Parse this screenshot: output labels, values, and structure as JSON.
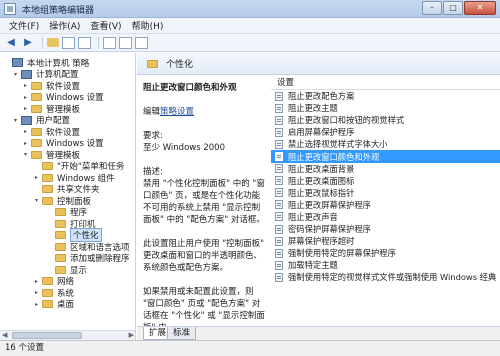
{
  "window": {
    "title": "本地组策略编辑器",
    "controls": [
      "–",
      "□",
      "✕"
    ]
  },
  "menu": [
    "文件(F)",
    "操作(A)",
    "查看(V)",
    "帮助(H)"
  ],
  "toolbar": {
    "back": "◀",
    "forward": "▶"
  },
  "tree": [
    {
      "label": "本地计算机 策略",
      "level": 0,
      "exp": "",
      "icon": "computer"
    },
    {
      "label": "计算机配置",
      "level": 1,
      "exp": "▾",
      "icon": "computer"
    },
    {
      "label": "软件设置",
      "level": 2,
      "exp": "▸",
      "icon": "folder"
    },
    {
      "label": "Windows 设置",
      "level": 2,
      "exp": "▸",
      "icon": "folder"
    },
    {
      "label": "管理模板",
      "level": 2,
      "exp": "▸",
      "icon": "folder"
    },
    {
      "label": "用户配置",
      "level": 1,
      "exp": "▾",
      "icon": "computer"
    },
    {
      "label": "软件设置",
      "level": 2,
      "exp": "▸",
      "icon": "folder"
    },
    {
      "label": "Windows 设置",
      "level": 2,
      "exp": "▸",
      "icon": "folder"
    },
    {
      "label": "管理模板",
      "level": 2,
      "exp": "▾",
      "icon": "folder"
    },
    {
      "label": "\"开始\"菜单和任务",
      "level": 3,
      "exp": "",
      "icon": "folder"
    },
    {
      "label": "Windows 组件",
      "level": 3,
      "exp": "▸",
      "icon": "folder"
    },
    {
      "label": "共享文件夹",
      "level": 3,
      "exp": "",
      "icon": "folder"
    },
    {
      "label": "控制面板",
      "level": 3,
      "exp": "▾",
      "icon": "folder"
    },
    {
      "label": "程序",
      "level": 4,
      "exp": "",
      "icon": "folder"
    },
    {
      "label": "打印机",
      "level": 4,
      "exp": "",
      "icon": "folder"
    },
    {
      "label": "个性化",
      "level": 4,
      "exp": "",
      "icon": "folder",
      "selected": true
    },
    {
      "label": "区域和语言选项",
      "level": 4,
      "exp": "",
      "icon": "folder"
    },
    {
      "label": "添加或删除程序",
      "level": 4,
      "exp": "",
      "icon": "folder"
    },
    {
      "label": "显示",
      "level": 4,
      "exp": "",
      "icon": "folder"
    },
    {
      "label": "网络",
      "level": 3,
      "exp": "▸",
      "icon": "folder"
    },
    {
      "label": "系统",
      "level": 3,
      "exp": "▸",
      "icon": "folder"
    },
    {
      "label": "桌面",
      "level": 3,
      "exp": "▸",
      "icon": "folder"
    }
  ],
  "right_header": "个性化",
  "description": {
    "title": "阻止更改窗口颜色和外观",
    "edit_prefix": "编辑",
    "edit_link": "策略设置",
    "requirement": "要求:\n至少 Windows 2000",
    "desc_label": "描述:",
    "desc_body": "禁用 \"个性化控制面板\" 中的 \"窗口颜色\" 页，或是在个性化功能不可用的系统上禁用 \"显示控制面板\" 中的 \"配色方案\" 对话框。",
    "p2": "此设置阻止用户使用 \"控制面板\" 更改桌面和窗口的半透明颜色、系统颜色或配色方案。",
    "p3": "如果禁用或未配置此设置，则 \"窗口颜色\" 页或 \"配色方案\" 对话框在 \"个性化\" 或 \"显示控制面板\" 中"
  },
  "settings_header": "设置",
  "settings": [
    "阻止更改配色方案",
    "阻止更改主题",
    "阻止更改窗口和按钮的视觉样式",
    "启用屏幕保护程序",
    "禁止选择视觉样式字体大小",
    "阻止更改窗口颜色和外观",
    "阻止更改桌面背景",
    "阻止更改桌面图标",
    "阻止更改鼠标指针",
    "阻止更改屏幕保护程序",
    "阻止更改声音",
    "密码保护屏幕保护程序",
    "屏幕保护程序超时",
    "强制使用特定的屏幕保护程序",
    "加载特定主题",
    "强制使用特定的视觉样式文件或强制使用 Windows 经典"
  ],
  "selected_setting_index": 5,
  "tabs": [
    "扩展",
    "标准"
  ],
  "status": "16 个设置",
  "colors": {
    "selection": "#3399ff",
    "title_bar": "#c6d9ef"
  }
}
